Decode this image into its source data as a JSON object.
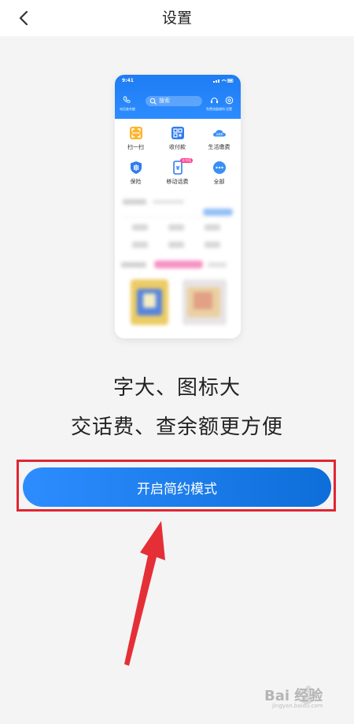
{
  "header": {
    "title": "设置",
    "back_icon": "chevron-left-icon"
  },
  "preview": {
    "status_time": "9:41",
    "phone_label": "电话查余额",
    "search_placeholder": "搜索",
    "service_label": "免费流量福利",
    "settings_label": "设置",
    "grid": [
      {
        "label": "扫一扫",
        "icon": "scan-icon",
        "color": "#f6a623"
      },
      {
        "label": "收付款",
        "icon": "qr-code-icon",
        "color": "#2f7cf0"
      },
      {
        "label": "生活缴费",
        "icon": "cloud-icon",
        "color": "#2f8df5",
        "icon_text": "云缴费"
      },
      {
        "label": "保险",
        "icon": "shield-icon",
        "color": "#2f7cf0"
      },
      {
        "label": "移动话费",
        "icon": "mobile-icon",
        "color": "#2f7cf0",
        "badge": "去充值"
      },
      {
        "label": "全部",
        "icon": "more-icon",
        "color": "#2f8df5"
      }
    ]
  },
  "tagline": {
    "line1": "字大、图标大",
    "line2": "交话费、查余额更方便"
  },
  "primary_button": {
    "label": "开启简约模式",
    "color": "#1f7ef2"
  },
  "highlight_color": "#e02633",
  "watermark": {
    "text": "Bai 经验",
    "sub": "jingyan.baidu.com"
  }
}
